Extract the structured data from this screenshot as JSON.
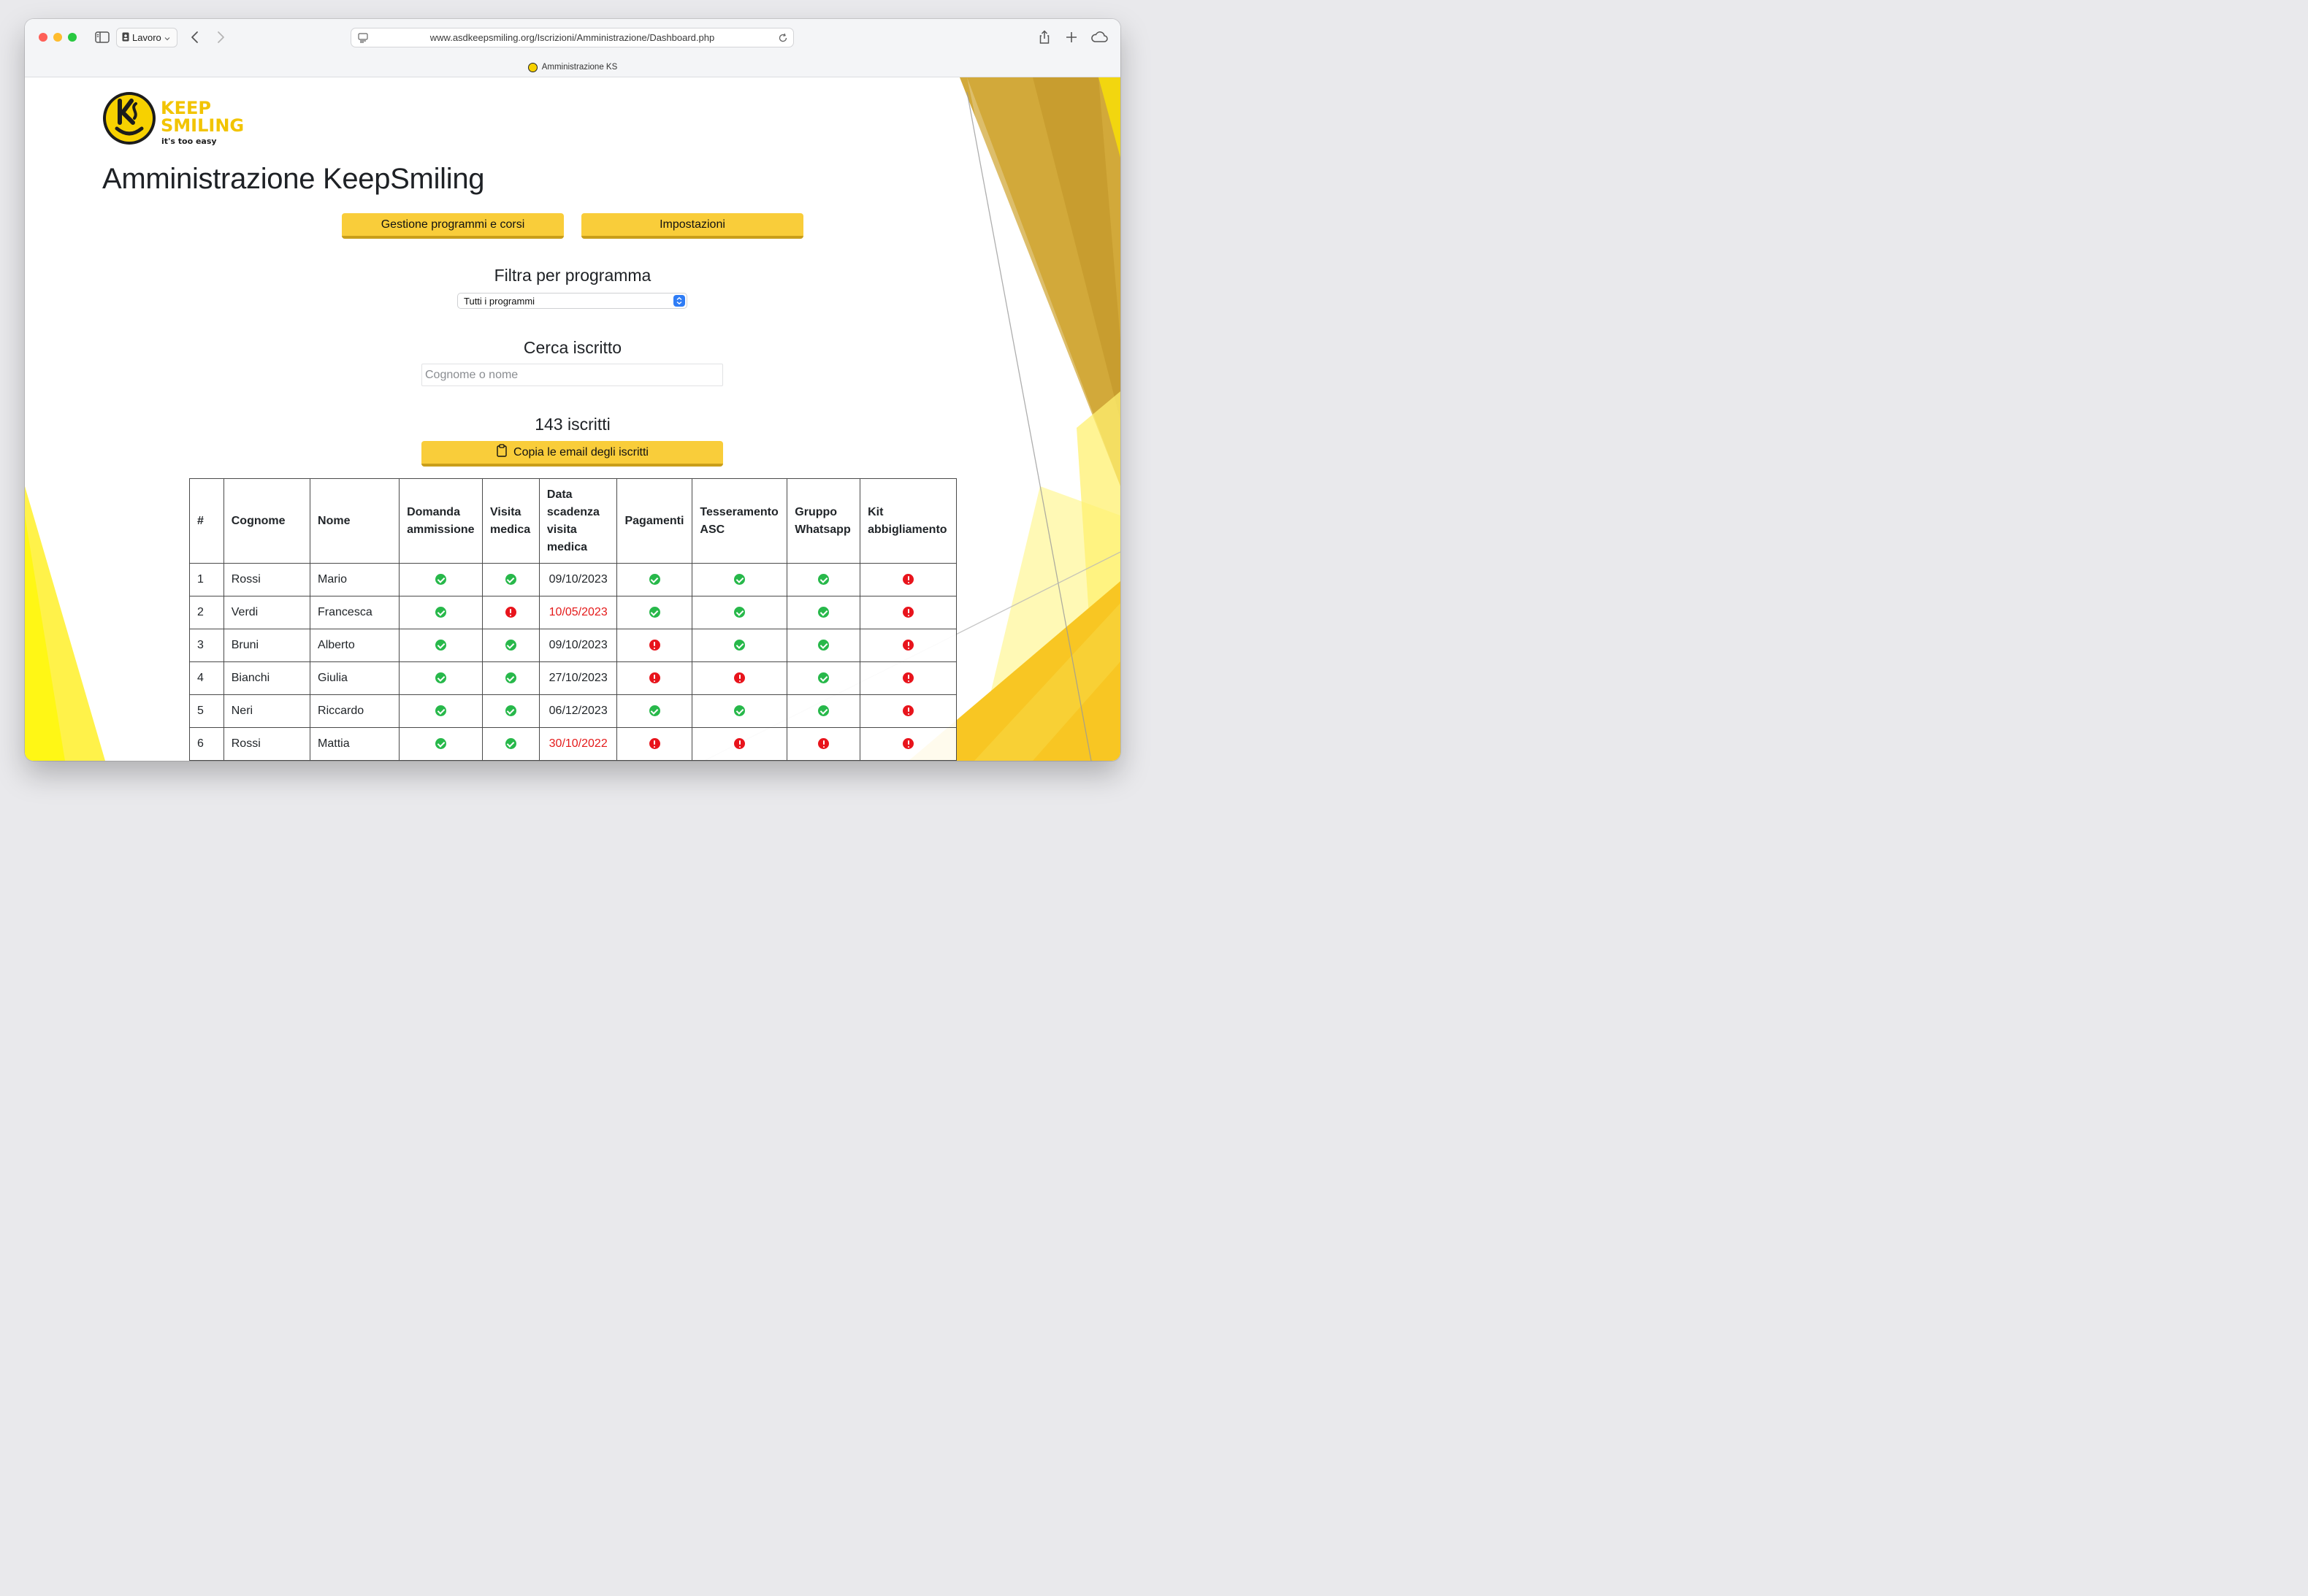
{
  "browser": {
    "profile_label": "Lavoro",
    "url": "www.asdkeepsmiling.org/Iscrizioni/Amministrazione/Dashboard.php",
    "tab_title": "Amministrazione KS"
  },
  "logo": {
    "line1": "KEEP",
    "line2": "SMILING",
    "tagline": "it's too easy",
    "brand_color": "#f7d100"
  },
  "page": {
    "title": "Amministrazione KeepSmiling",
    "nav_buttons": {
      "programmi": "Gestione programmi e corsi",
      "impostazioni": "Impostazioni"
    },
    "filter": {
      "title": "Filtra per programma",
      "selected": "Tutti i programmi"
    },
    "search": {
      "title": "Cerca iscritto",
      "placeholder": "Cognome o nome"
    },
    "count_label": "143 iscritti",
    "copy_button_label": "Copia le email degli iscritti"
  },
  "table": {
    "headers": {
      "num": "#",
      "cognome": "Cognome",
      "nome": "Nome",
      "domanda": [
        "Domanda",
        "ammissione"
      ],
      "visita": [
        "Visita",
        "medica"
      ],
      "scadenza": [
        "Data",
        "scadenza",
        "visita",
        "medica"
      ],
      "pagamenti": "Pagamenti",
      "tesseramento": [
        "Tesseramento",
        "ASC"
      ],
      "whatsapp": [
        "Gruppo",
        "Whatsapp"
      ],
      "kit": [
        "Kit",
        "abbigliamento"
      ]
    },
    "rows": [
      {
        "n": "1",
        "cognome": "Rossi",
        "nome": "Mario",
        "domanda": "ok",
        "visita": "ok",
        "scadenza": "09/10/2023",
        "scaduta": false,
        "pagamenti": "ok",
        "tesseramento": "ok",
        "whatsapp": "ok",
        "kit": "ko"
      },
      {
        "n": "2",
        "cognome": "Verdi",
        "nome": "Francesca",
        "domanda": "ok",
        "visita": "ko",
        "scadenza": "10/05/2023",
        "scaduta": true,
        "pagamenti": "ok",
        "tesseramento": "ok",
        "whatsapp": "ok",
        "kit": "ko"
      },
      {
        "n": "3",
        "cognome": "Bruni",
        "nome": "Alberto",
        "domanda": "ok",
        "visita": "ok",
        "scadenza": "09/10/2023",
        "scaduta": false,
        "pagamenti": "ko",
        "tesseramento": "ok",
        "whatsapp": "ok",
        "kit": "ko"
      },
      {
        "n": "4",
        "cognome": "Bianchi",
        "nome": "Giulia",
        "domanda": "ok",
        "visita": "ok",
        "scadenza": "27/10/2023",
        "scaduta": false,
        "pagamenti": "ko",
        "tesseramento": "ko",
        "whatsapp": "ok",
        "kit": "ko"
      },
      {
        "n": "5",
        "cognome": "Neri",
        "nome": "Riccardo",
        "domanda": "ok",
        "visita": "ok",
        "scadenza": "06/12/2023",
        "scaduta": false,
        "pagamenti": "ok",
        "tesseramento": "ok",
        "whatsapp": "ok",
        "kit": "ko"
      },
      {
        "n": "6",
        "cognome": "Rossi",
        "nome": "Mattia",
        "domanda": "ok",
        "visita": "ok",
        "scadenza": "30/10/2022",
        "scaduta": true,
        "pagamenti": "ko",
        "tesseramento": "ko",
        "whatsapp": "ko",
        "kit": "ko"
      }
    ]
  },
  "colors": {
    "accent_button": "#f9cd3a",
    "ok": "#27b84a",
    "ko": "#e8141c",
    "expired_date": "#e41a1a"
  }
}
